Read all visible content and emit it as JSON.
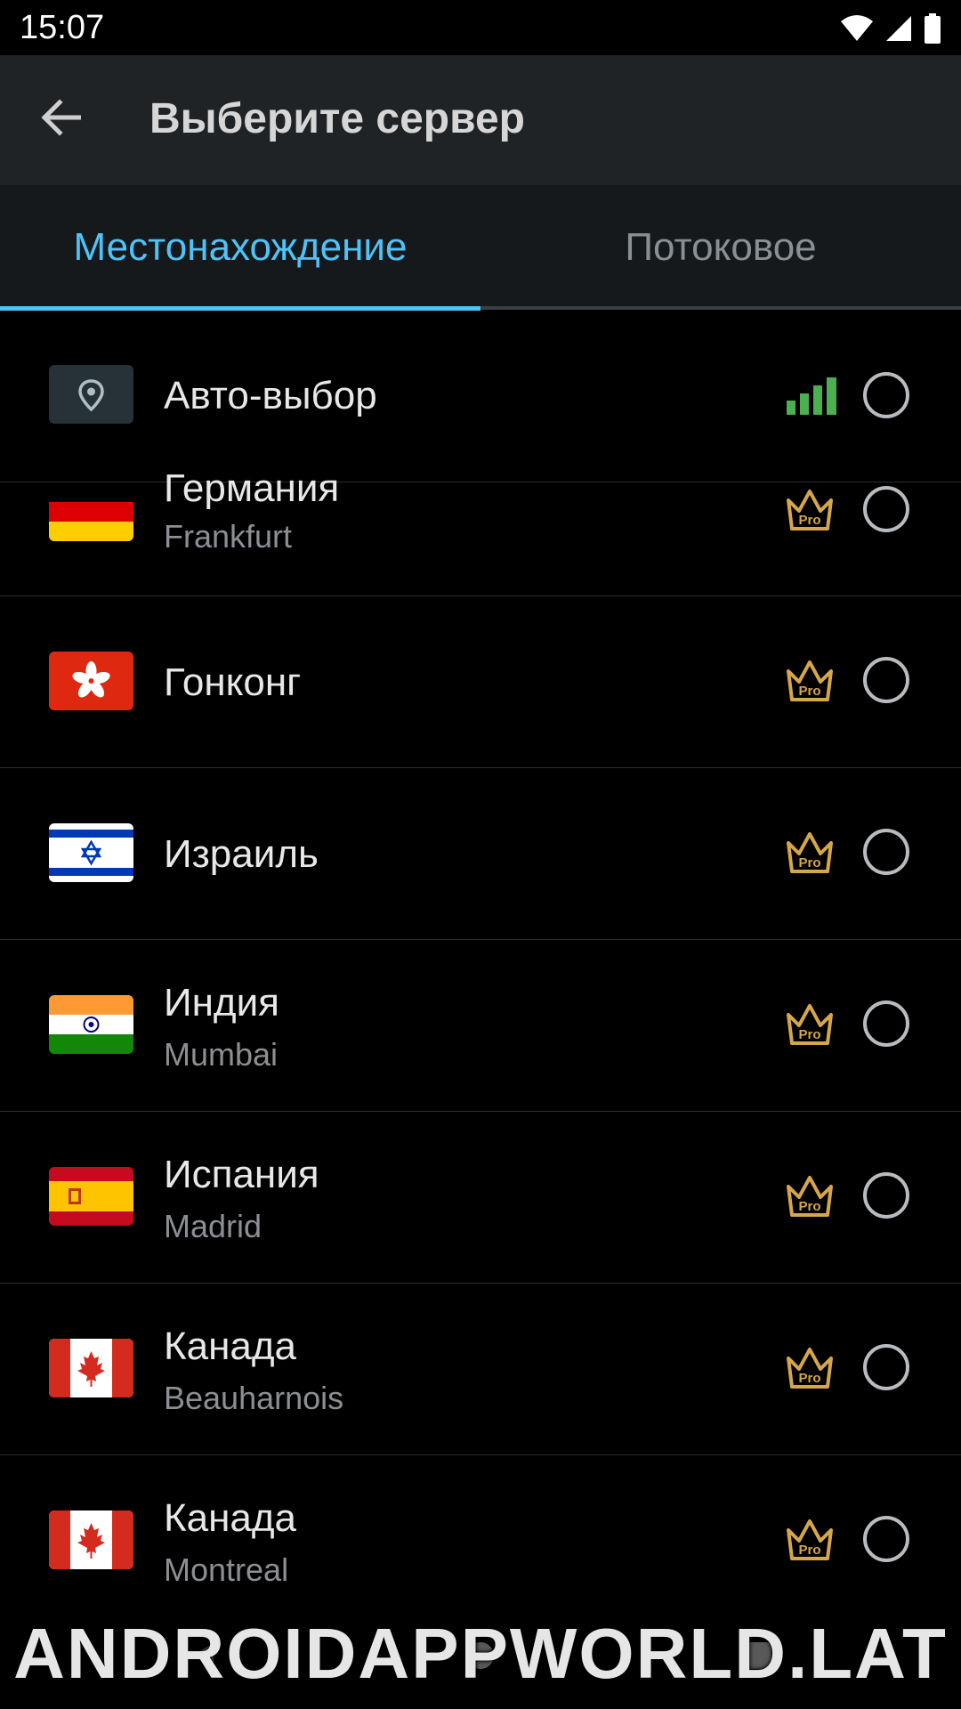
{
  "status_bar": {
    "time": "15:07"
  },
  "app_bar": {
    "title": "Выберите сервер"
  },
  "tabs": [
    {
      "label": "Местонахождение",
      "selected": true
    },
    {
      "label": "Потоковое",
      "selected": false
    }
  ],
  "accent_color": "#4fc3f7",
  "pro_color": "#d6a64a",
  "signal_color": "#4caf50",
  "auto_select": {
    "label": "Авто-выбор",
    "icon": "location-pin-icon"
  },
  "servers": [
    {
      "country": "Германия",
      "city": "Frankfurt",
      "flag": "germany-flag-icon",
      "badge": "Pro"
    },
    {
      "country": "Гонконг",
      "city": "",
      "flag": "hong-kong-flag-icon",
      "badge": "Pro"
    },
    {
      "country": "Израиль",
      "city": "",
      "flag": "israel-flag-icon",
      "badge": "Pro"
    },
    {
      "country": "Индия",
      "city": "Mumbai",
      "flag": "india-flag-icon",
      "badge": "Pro"
    },
    {
      "country": "Испания",
      "city": "Madrid",
      "flag": "spain-flag-icon",
      "badge": "Pro"
    },
    {
      "country": "Канада",
      "city": "Beauharnois",
      "flag": "canada-flag-icon",
      "badge": "Pro"
    },
    {
      "country": "Канада",
      "city": "Montreal",
      "flag": "canada-flag-icon",
      "badge": "Pro"
    }
  ],
  "watermark": "ANDROIDAPPWORLD.LAT"
}
